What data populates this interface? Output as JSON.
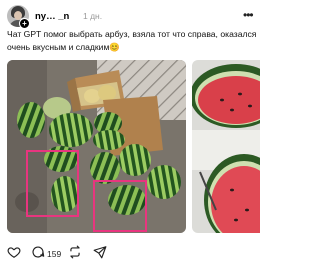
{
  "header": {
    "username": "ny… _n",
    "time": "1 дн.",
    "follow_symbol": "+",
    "more_symbol": "•••"
  },
  "caption": "Чат GPT помог выбрать арбуз, взяла тот что справа, оказался очень вкусным и сладким😊",
  "actions": {
    "comment_count": "159"
  },
  "colors": {
    "highlight_box": "#e8357f",
    "watermelon_dark": "#1f4d1f",
    "watermelon_light": "#7fb24a",
    "flesh": "#d9404a"
  },
  "icons": [
    "heart-icon",
    "comment-icon",
    "repost-icon",
    "share-icon",
    "more-icon",
    "plus-icon"
  ]
}
